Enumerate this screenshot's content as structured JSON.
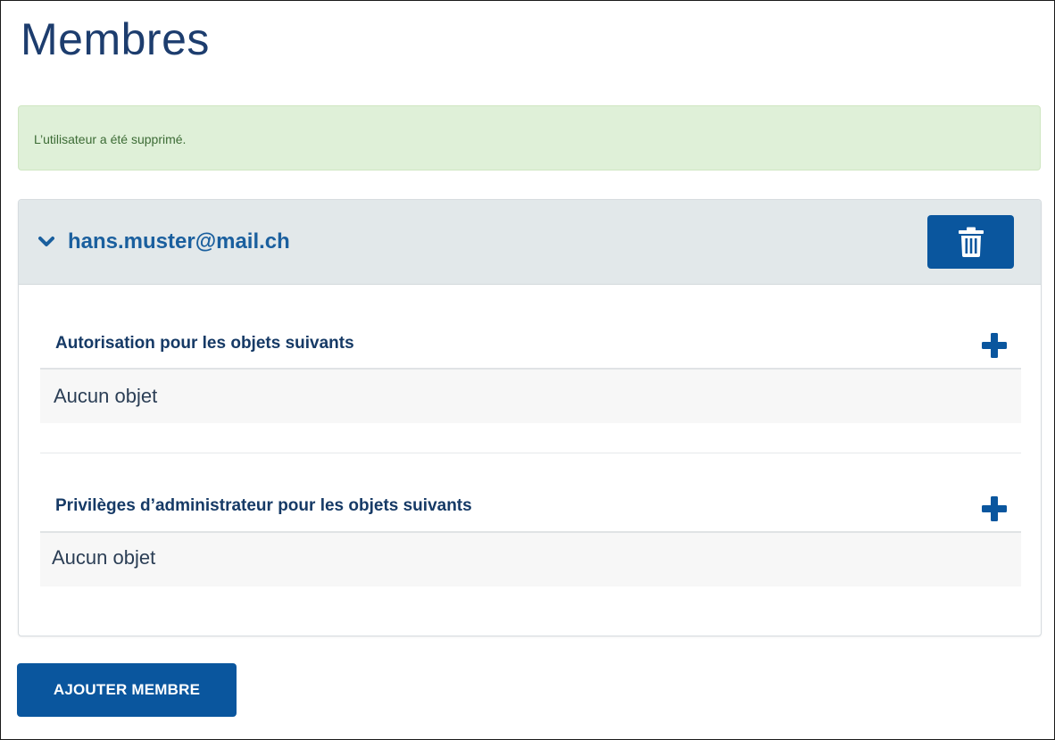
{
  "page": {
    "title": "Membres"
  },
  "alert": {
    "message": "L’utilisateur a été supprimé."
  },
  "member": {
    "email": "hans.muster@mail.ch",
    "toggle_icon": "chevron-down-icon",
    "delete_icon": "trash-icon"
  },
  "sections": [
    {
      "title": "Autorisation pour les objets suivants",
      "add_icon": "plus-icon",
      "empty_text": "Aucun objet"
    },
    {
      "title": "Privilèges d’administrateur pour les objets suivants",
      "add_icon": "plus-icon",
      "empty_text": "Aucun objet"
    }
  ],
  "actions": {
    "add_member_label": "AJOUTER MEMBRE"
  },
  "colors": {
    "primary": "#0a569e",
    "title": "#1d3d6e",
    "link": "#1a5f9e",
    "alert_bg": "#dff0d8",
    "alert_text": "#3c6b35",
    "header_bg": "#e2e8ea"
  }
}
